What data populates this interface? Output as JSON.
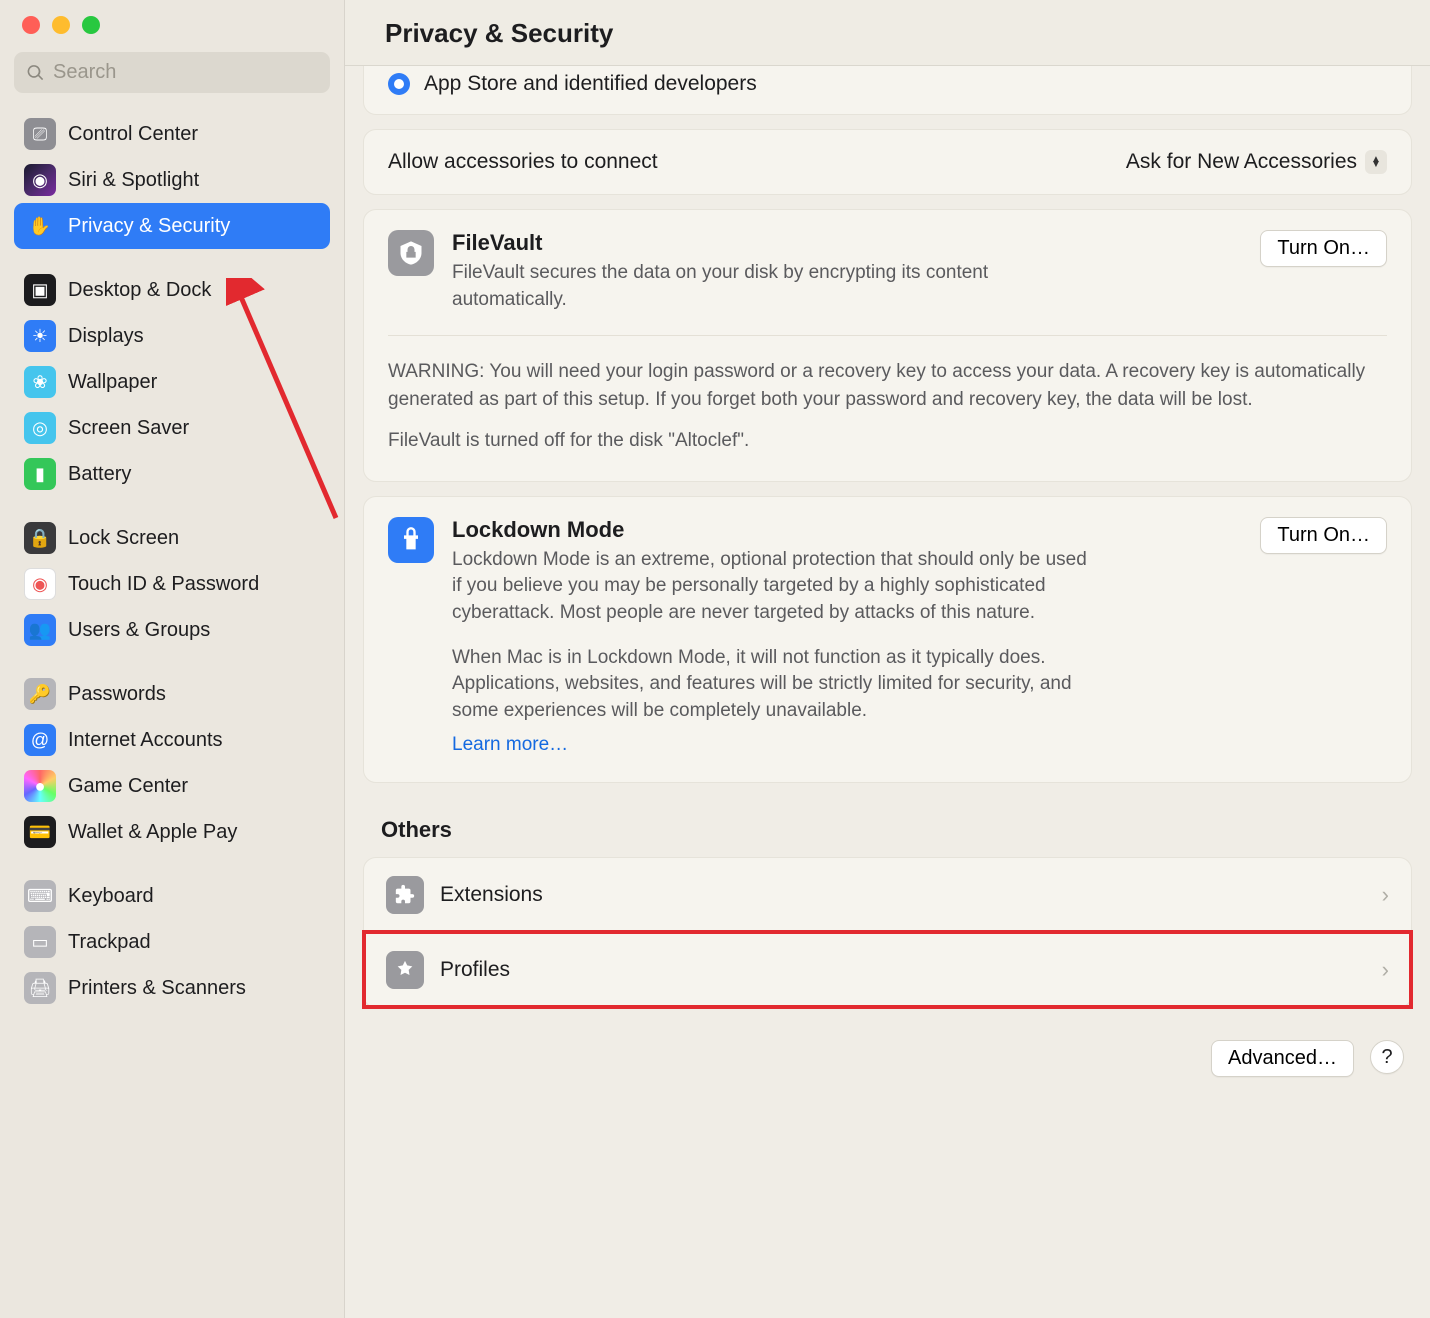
{
  "search": {
    "placeholder": "Search"
  },
  "sidebar": {
    "items": [
      {
        "label": "Control Center",
        "bg": "bg-gray",
        "glyph": "⎚"
      },
      {
        "label": "Siri & Spotlight",
        "bg": "bg-grad-siri",
        "glyph": "◉"
      },
      {
        "label": "Privacy & Security",
        "bg": "bg-blue2",
        "glyph": "✋",
        "selected": true
      },
      {
        "spacer": true
      },
      {
        "label": "Desktop & Dock",
        "bg": "bg-black",
        "glyph": "▣"
      },
      {
        "label": "Displays",
        "bg": "bg-blued",
        "glyph": "☀"
      },
      {
        "label": "Wallpaper",
        "bg": "bg-cyan",
        "glyph": "❀"
      },
      {
        "label": "Screen Saver",
        "bg": "bg-teal",
        "glyph": "◎"
      },
      {
        "label": "Battery",
        "bg": "bg-green",
        "glyph": "▮"
      },
      {
        "spacer": true
      },
      {
        "label": "Lock Screen",
        "bg": "bg-darkgray",
        "glyph": "🔒"
      },
      {
        "label": "Touch ID & Password",
        "bg": "bg-white",
        "glyph": "◉"
      },
      {
        "label": "Users & Groups",
        "bg": "bg-blued",
        "glyph": "👥"
      },
      {
        "spacer": true
      },
      {
        "label": "Passwords",
        "bg": "bg-lightgray",
        "glyph": "🔑"
      },
      {
        "label": "Internet Accounts",
        "bg": "bg-at",
        "glyph": "@"
      },
      {
        "label": "Game Center",
        "bg": "bg-rainbow",
        "glyph": "●"
      },
      {
        "label": "Wallet & Apple Pay",
        "bg": "bg-black",
        "glyph": "💳"
      },
      {
        "spacer": true
      },
      {
        "label": "Keyboard",
        "bg": "bg-lightgray",
        "glyph": "⌨"
      },
      {
        "label": "Trackpad",
        "bg": "bg-lightgray",
        "glyph": "▭"
      },
      {
        "label": "Printers & Scanners",
        "bg": "bg-lightgray",
        "glyph": "🖨"
      }
    ]
  },
  "header": {
    "title": "Privacy & Security"
  },
  "partial_radio": {
    "label": "App Store and identified developers"
  },
  "accessories": {
    "label": "Allow accessories to connect",
    "value": "Ask for New Accessories"
  },
  "filevault": {
    "title": "FileVault",
    "desc": "FileVault secures the data on your disk by encrypting its content automatically.",
    "button": "Turn On…",
    "warning": "WARNING: You will need your login password or a recovery key to access your data. A recovery key is automatically generated as part of this setup. If you forget both your password and recovery key, the data will be lost.",
    "status": "FileVault is turned off for the disk \"Altoclef\"."
  },
  "lockdown": {
    "title": "Lockdown Mode",
    "desc1": "Lockdown Mode is an extreme, optional protection that should only be used if you believe you may be personally targeted by a highly sophisticated cyberattack. Most people are never targeted by attacks of this nature.",
    "desc2": "When Mac is in Lockdown Mode, it will not function as it typically does. Applications, websites, and features will be strictly limited for security, and some experiences will be completely unavailable.",
    "learn": "Learn more…",
    "button": "Turn On…"
  },
  "others": {
    "title": "Others",
    "rows": [
      {
        "label": "Extensions",
        "name": "extensions-row"
      },
      {
        "label": "Profiles",
        "name": "profiles-row",
        "highlighted": true
      }
    ]
  },
  "footer": {
    "advanced": "Advanced…"
  }
}
